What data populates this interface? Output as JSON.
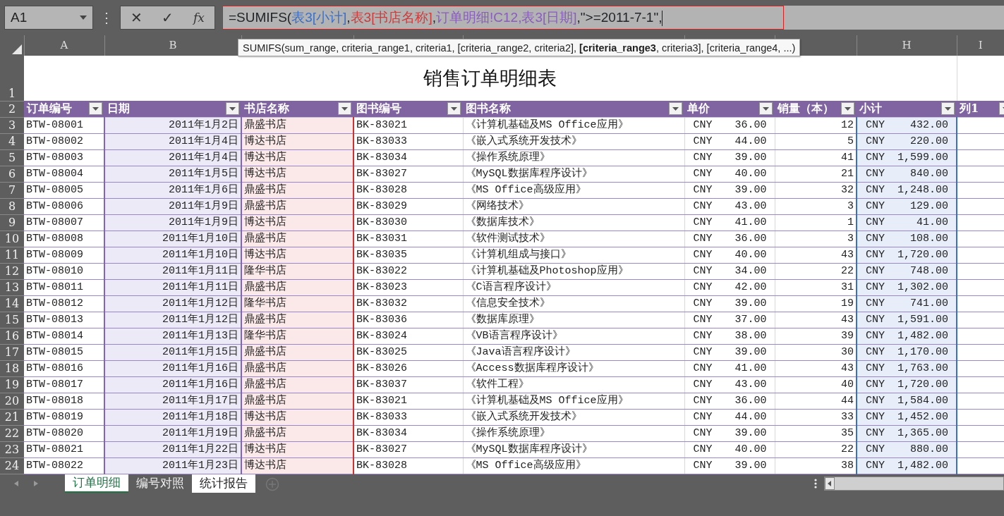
{
  "formula_bar": {
    "name_box": "A1",
    "more": "⋮",
    "cancel": "✕",
    "enter": "✓",
    "function": "fx",
    "formula": [
      {
        "text": "=SUMIFS("
      },
      {
        "text": "表3[小计]",
        "color": "#3a6fc8"
      },
      {
        "text": ","
      },
      {
        "text": "表3[书店名称]",
        "color": "#d03a3a"
      },
      {
        "text": ","
      },
      {
        "text": "订单明细!C12,表3[日期]",
        "color": "#8a5cc0"
      },
      {
        "text": ",\">=2011-7-1\","
      }
    ]
  },
  "tooltip": "SUMIFS(sum_range, criteria_range1, criteria1, [criteria_range2, criteria2], **[criteria_range3**, criteria3], [criteria_range4, ...)",
  "columns": [
    {
      "letter": "A",
      "header": "订单编号"
    },
    {
      "letter": "B",
      "header": "日期",
      "color": "#8064c0"
    },
    {
      "header": "书店名称",
      "color": "#d03030"
    },
    {
      "header": "图书编号"
    },
    {
      "header": "图书名称"
    },
    {
      "header": "单价"
    },
    {
      "header": "销量（本）"
    },
    {
      "letter": "H",
      "header": "小计",
      "color": "#3a6fc8"
    },
    {
      "letter": "I",
      "header": "列1"
    }
  ],
  "title_row": {
    "number": "1",
    "title": "销售订单明细表"
  },
  "header_row_number": "2",
  "rows": [
    {
      "n": "3",
      "cells": [
        "BTW-08001",
        "2011年1月2日",
        "鼎盛书店",
        "BK-83021",
        "《计算机基础及MS Office应用》",
        "CNY",
        "36.00",
        "12",
        "CNY",
        "432.00"
      ]
    },
    {
      "n": "4",
      "cells": [
        "BTW-08002",
        "2011年1月4日",
        "博达书店",
        "BK-83033",
        "《嵌入式系统开发技术》",
        "CNY",
        "44.00",
        "5",
        "CNY",
        "220.00"
      ]
    },
    {
      "n": "5",
      "cells": [
        "BTW-08003",
        "2011年1月4日",
        "博达书店",
        "BK-83034",
        "《操作系统原理》",
        "CNY",
        "39.00",
        "41",
        "CNY",
        "1,599.00"
      ]
    },
    {
      "n": "6",
      "cells": [
        "BTW-08004",
        "2011年1月5日",
        "博达书店",
        "BK-83027",
        "《MySQL数据库程序设计》",
        "CNY",
        "40.00",
        "21",
        "CNY",
        "840.00"
      ]
    },
    {
      "n": "7",
      "cells": [
        "BTW-08005",
        "2011年1月6日",
        "鼎盛书店",
        "BK-83028",
        "《MS Office高级应用》",
        "CNY",
        "39.00",
        "32",
        "CNY",
        "1,248.00"
      ]
    },
    {
      "n": "8",
      "cells": [
        "BTW-08006",
        "2011年1月9日",
        "鼎盛书店",
        "BK-83029",
        "《网络技术》",
        "CNY",
        "43.00",
        "3",
        "CNY",
        "129.00"
      ]
    },
    {
      "n": "9",
      "cells": [
        "BTW-08007",
        "2011年1月9日",
        "博达书店",
        "BK-83030",
        "《数据库技术》",
        "CNY",
        "41.00",
        "1",
        "CNY",
        "41.00"
      ]
    },
    {
      "n": "10",
      "cells": [
        "BTW-08008",
        "2011年1月10日",
        "鼎盛书店",
        "BK-83031",
        "《软件测试技术》",
        "CNY",
        "36.00",
        "3",
        "CNY",
        "108.00"
      ]
    },
    {
      "n": "11",
      "cells": [
        "BTW-08009",
        "2011年1月10日",
        "博达书店",
        "BK-83035",
        "《计算机组成与接口》",
        "CNY",
        "40.00",
        "43",
        "CNY",
        "1,720.00"
      ]
    },
    {
      "n": "12",
      "cells": [
        "BTW-08010",
        "2011年1月11日",
        "隆华书店",
        "BK-83022",
        "《计算机基础及Photoshop应用》",
        "CNY",
        "34.00",
        "22",
        "CNY",
        "748.00"
      ]
    },
    {
      "n": "13",
      "cells": [
        "BTW-08011",
        "2011年1月11日",
        "鼎盛书店",
        "BK-83023",
        "《C语言程序设计》",
        "CNY",
        "42.00",
        "31",
        "CNY",
        "1,302.00"
      ]
    },
    {
      "n": "14",
      "cells": [
        "BTW-08012",
        "2011年1月12日",
        "隆华书店",
        "BK-83032",
        "《信息安全技术》",
        "CNY",
        "39.00",
        "19",
        "CNY",
        "741.00"
      ]
    },
    {
      "n": "15",
      "cells": [
        "BTW-08013",
        "2011年1月12日",
        "鼎盛书店",
        "BK-83036",
        "《数据库原理》",
        "CNY",
        "37.00",
        "43",
        "CNY",
        "1,591.00"
      ]
    },
    {
      "n": "16",
      "cells": [
        "BTW-08014",
        "2011年1月13日",
        "隆华书店",
        "BK-83024",
        "《VB语言程序设计》",
        "CNY",
        "38.00",
        "39",
        "CNY",
        "1,482.00"
      ]
    },
    {
      "n": "17",
      "cells": [
        "BTW-08015",
        "2011年1月15日",
        "鼎盛书店",
        "BK-83025",
        "《Java语言程序设计》",
        "CNY",
        "39.00",
        "30",
        "CNY",
        "1,170.00"
      ]
    },
    {
      "n": "18",
      "cells": [
        "BTW-08016",
        "2011年1月16日",
        "鼎盛书店",
        "BK-83026",
        "《Access数据库程序设计》",
        "CNY",
        "41.00",
        "43",
        "CNY",
        "1,763.00"
      ]
    },
    {
      "n": "19",
      "cells": [
        "BTW-08017",
        "2011年1月16日",
        "鼎盛书店",
        "BK-83037",
        "《软件工程》",
        "CNY",
        "43.00",
        "40",
        "CNY",
        "1,720.00"
      ]
    },
    {
      "n": "20",
      "cells": [
        "BTW-08018",
        "2011年1月17日",
        "鼎盛书店",
        "BK-83021",
        "《计算机基础及MS Office应用》",
        "CNY",
        "36.00",
        "44",
        "CNY",
        "1,584.00"
      ]
    },
    {
      "n": "21",
      "cells": [
        "BTW-08019",
        "2011年1月18日",
        "博达书店",
        "BK-83033",
        "《嵌入式系统开发技术》",
        "CNY",
        "44.00",
        "33",
        "CNY",
        "1,452.00"
      ]
    },
    {
      "n": "22",
      "cells": [
        "BTW-08020",
        "2011年1月19日",
        "鼎盛书店",
        "BK-83034",
        "《操作系统原理》",
        "CNY",
        "39.00",
        "35",
        "CNY",
        "1,365.00"
      ]
    },
    {
      "n": "23",
      "cells": [
        "BTW-08021",
        "2011年1月22日",
        "博达书店",
        "BK-83027",
        "《MySQL数据库程序设计》",
        "CNY",
        "40.00",
        "22",
        "CNY",
        "880.00"
      ]
    },
    {
      "n": "24",
      "cells": [
        "BTW-08022",
        "2011年1月23日",
        "博达书店",
        "BK-83028",
        "《MS Office高级应用》",
        "CNY",
        "39.00",
        "38",
        "CNY",
        "1,482.00"
      ]
    }
  ],
  "sheet_tabs": [
    {
      "label": "订单明细",
      "selected": true,
      "active": true
    },
    {
      "label": "编号对照",
      "selected": false,
      "active": false
    },
    {
      "label": "统计报告",
      "selected": true,
      "active": false
    }
  ]
}
